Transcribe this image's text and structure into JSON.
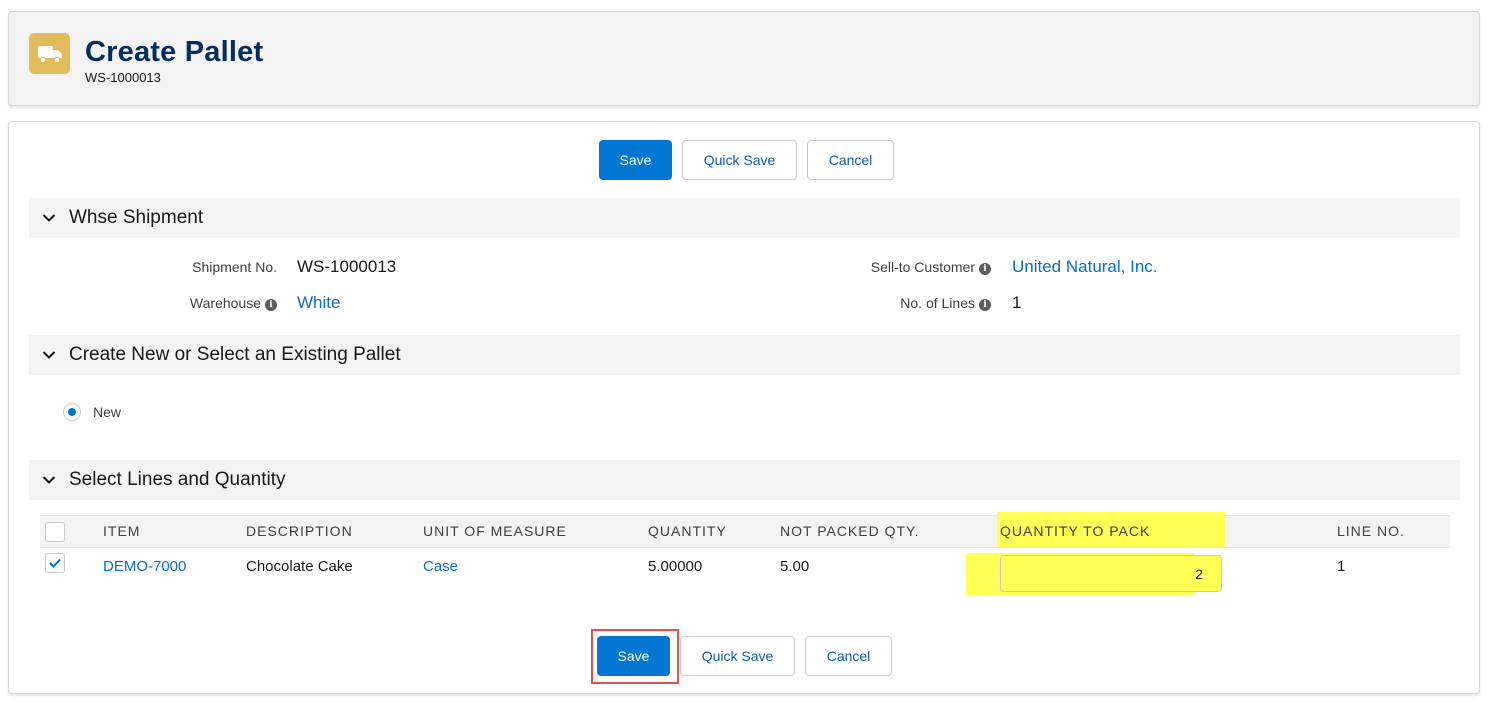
{
  "header": {
    "title": "Create Pallet",
    "subtitle": "WS-1000013",
    "icon": "truck-icon",
    "icon_color": "#e3bb5b"
  },
  "actions": {
    "save": "Save",
    "quick_save": "Quick Save",
    "cancel": "Cancel"
  },
  "sections": {
    "shipment": "Whse Shipment",
    "pallet": "Create New or Select an Existing Pallet",
    "lines": "Select Lines and Quantity"
  },
  "shipment_fields": {
    "shipment_no_label": "Shipment No.",
    "shipment_no_value": "WS-1000013",
    "warehouse_label": "Warehouse",
    "warehouse_value": "White",
    "customer_label": "Sell-to Customer",
    "customer_value": "United Natural, Inc.",
    "lines_label": "No. of Lines",
    "lines_value": "1"
  },
  "pallet_option": {
    "label": "New",
    "selected": true
  },
  "table": {
    "columns": [
      "ITEM",
      "DESCRIPTION",
      "UNIT OF MEASURE",
      "QUANTITY",
      "NOT PACKED QTY.",
      "QUANTITY TO PACK",
      "LINE NO."
    ],
    "rows": [
      {
        "selected": true,
        "item": "DEMO-7000",
        "description": "Chocolate Cake",
        "uom": "Case",
        "quantity": "5.00000",
        "not_packed": "5.00",
        "qty_to_pack": "2",
        "line_no": "1"
      }
    ]
  },
  "colors": {
    "brand": "#0176d3",
    "link": "#0b6ebf",
    "highlight": "#ffff55",
    "callout": "#d9544f"
  }
}
